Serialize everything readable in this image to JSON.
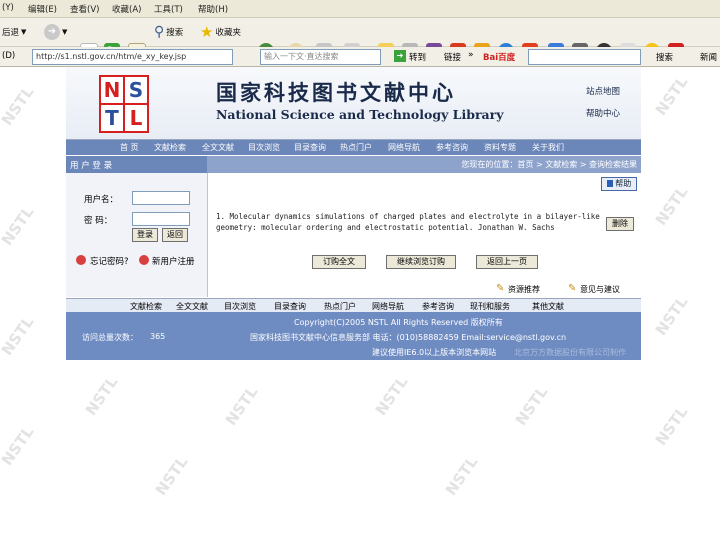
{
  "browser": {
    "menu": [
      "(Y)",
      "编辑(E)",
      "查看(V)",
      "收藏(A)",
      "工具(T)",
      "帮助(H)"
    ],
    "toolbar": {
      "back_label": "后退",
      "search_label": "搜索",
      "favorites_label": "收藏夹"
    },
    "address": {
      "label": "(D)",
      "url": "http://s1.nstl.gov.cn/htm/e_xy_key.jsp",
      "search_placeholder": "输入一下文·直达搜索",
      "goto_label": "转到",
      "links_label": "链接",
      "chevrons": "»",
      "baidu_label": "Bai百度",
      "search_button_label": "搜索",
      "trailing_label": "新闻"
    }
  },
  "watermark": "NSTL",
  "site": {
    "logo_letters": [
      "N",
      "S",
      "T",
      "L"
    ],
    "title_cn": "国家科技图书文献中心",
    "title_en": "National Science and Technology Library",
    "top_links": [
      "站点地图",
      "帮助中心"
    ]
  },
  "nav": [
    "首 页",
    "文献检索",
    "全文文献",
    "目次浏览",
    "目录查询",
    "热点门户",
    "网络导航",
    "参考咨询",
    "资料专题",
    "关于我们"
  ],
  "breadcrumb": "您现在的位置：首页 > 文献检索 > 查询检索结果",
  "sidebar": {
    "header": "用 户 登 录",
    "username_label": "用户名：",
    "password_label": "密  码：",
    "login_button": "登录",
    "back_button": "返回",
    "forgot_label": "忘记密码?",
    "register_label": "新用户注册"
  },
  "main": {
    "help_button": "帮助",
    "result_text": "1. Molecular dynamics simulations of charged plates and electrolyte in a bilayer-like geometry: molecular ordering and electrostatic potential. Jonathan W. Sachs",
    "remove_button": "删除",
    "buttons": [
      "订购全文",
      "继续浏览订购",
      "返回上一页"
    ],
    "recommend_link": "资源推荐",
    "feedback_link": "意见与建议"
  },
  "footer": {
    "links": [
      "文献检索",
      "全文文献",
      "目次浏览",
      "目录查询",
      "热点门户",
      "网络导航",
      "参考咨询",
      "现刊和服务",
      "其他文献"
    ],
    "copyright": "Copyright(C)2005 NSTL All Rights Reserved 版权所有",
    "visits_label": "访问总量次数：",
    "visits_count": "365",
    "contact": "国家科技图书文献中心信息服务部 电话：(010)58882459  Email:service@nstl.gov.cn",
    "note": "建议使用IE6.0以上版本浏览本网站",
    "note_faint": "北京万方数据股份有限公司制作"
  }
}
